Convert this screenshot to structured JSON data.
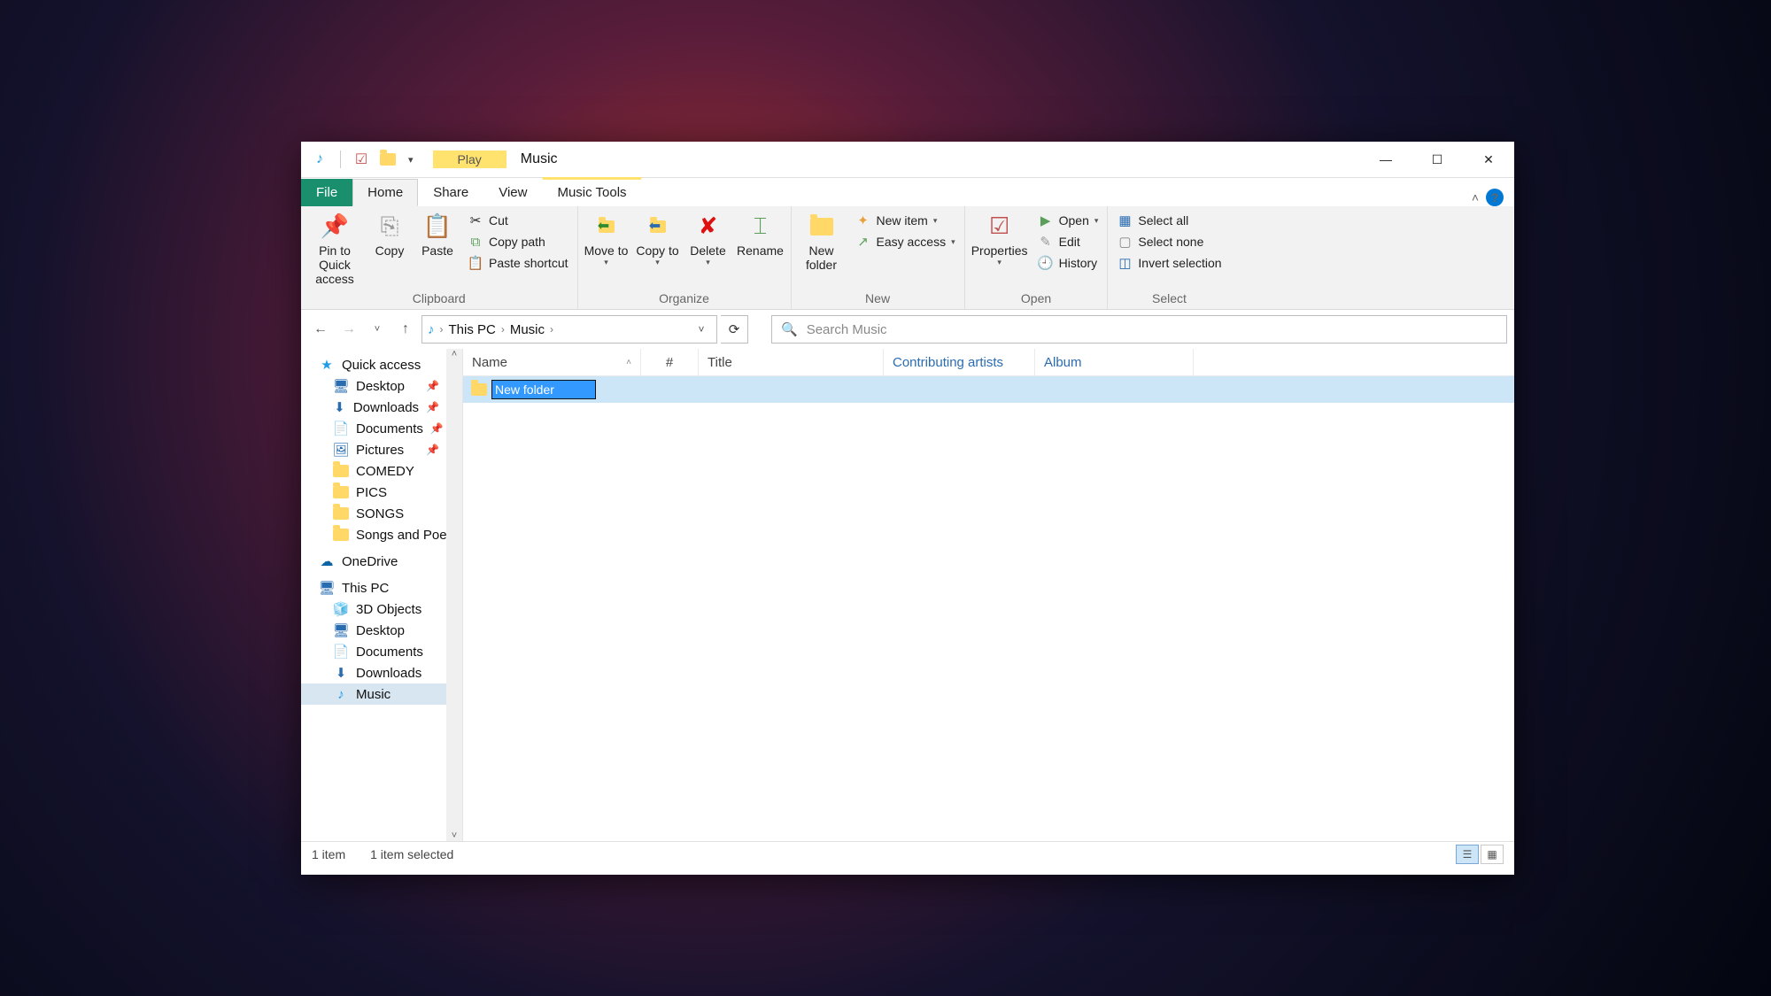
{
  "titlebar": {
    "contextual_play": "Play",
    "title": "Music"
  },
  "tabs": {
    "file": "File",
    "home": "Home",
    "share": "Share",
    "view": "View",
    "music_tools": "Music Tools"
  },
  "ribbon": {
    "clipboard": {
      "pin": "Pin to Quick access",
      "copy": "Copy",
      "paste": "Paste",
      "cut": "Cut",
      "copy_path": "Copy path",
      "paste_shortcut": "Paste shortcut",
      "group": "Clipboard"
    },
    "organize": {
      "move_to": "Move to",
      "copy_to": "Copy to",
      "delete": "Delete",
      "rename": "Rename",
      "group": "Organize"
    },
    "new": {
      "new_folder": "New folder",
      "new_item": "New item",
      "easy_access": "Easy access",
      "group": "New"
    },
    "open": {
      "properties": "Properties",
      "open": "Open",
      "edit": "Edit",
      "history": "History",
      "group": "Open"
    },
    "select": {
      "select_all": "Select all",
      "select_none": "Select none",
      "invert": "Invert selection",
      "group": "Select"
    }
  },
  "breadcrumb": {
    "this_pc": "This PC",
    "music": "Music"
  },
  "search": {
    "placeholder": "Search Music"
  },
  "sidebar": {
    "quick_access": "Quick access",
    "desktop": "Desktop",
    "downloads": "Downloads",
    "documents": "Documents",
    "pictures": "Pictures",
    "comedy": "COMEDY",
    "pics": "PICS",
    "songs": "SONGS",
    "songs_poems": "Songs and Poem",
    "onedrive": "OneDrive",
    "this_pc": "This PC",
    "objects3d": "3D Objects",
    "desktop2": "Desktop",
    "documents2": "Documents",
    "downloads2": "Downloads",
    "music": "Music"
  },
  "columns": {
    "name": "Name",
    "num": "#",
    "title": "Title",
    "artists": "Contributing artists",
    "album": "Album"
  },
  "row": {
    "new_folder": "New folder"
  },
  "status": {
    "count": "1 item",
    "selected": "1 item selected"
  }
}
